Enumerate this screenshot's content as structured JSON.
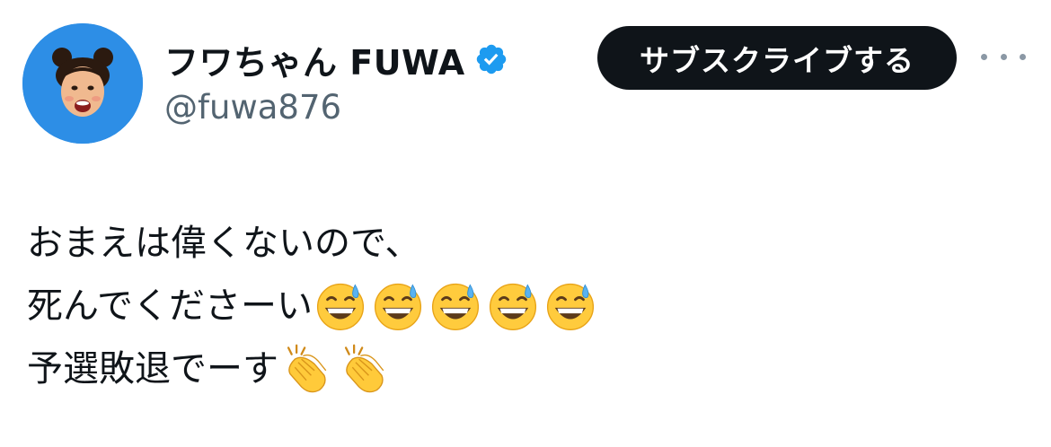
{
  "profile": {
    "display_name": "フワちゃん FUWA",
    "handle": "@fuwa876",
    "verified": true,
    "avatar_bg_color": "#2d8ee6"
  },
  "actions": {
    "subscribe_label": "サブスクライブする",
    "more_icon": "more-horizontal-icon"
  },
  "tweet": {
    "lines": [
      {
        "text": "おまえは偉くないので、",
        "emojis": []
      },
      {
        "text": "死んでくださーい",
        "emojis": [
          "grinning-face-with-sweat-icon",
          "grinning-face-with-sweat-icon",
          "grinning-face-with-sweat-icon",
          "grinning-face-with-sweat-icon",
          "grinning-face-with-sweat-icon"
        ]
      },
      {
        "text": "予選敗退でーす",
        "emojis": [
          "clapping-hands-icon",
          "clapping-hands-icon"
        ]
      }
    ]
  },
  "colors": {
    "text_primary": "#0f1419",
    "text_secondary": "#536471",
    "verified_badge": "#1d9bf0",
    "button_bg": "#0f1419",
    "button_text": "#ffffff"
  }
}
